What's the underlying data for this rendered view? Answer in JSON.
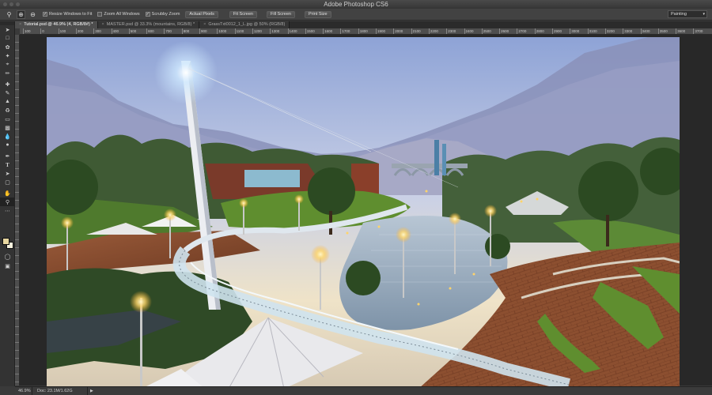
{
  "app": {
    "title": "Adobe Photoshop CS6"
  },
  "options_bar": {
    "checkboxes": [
      {
        "label": "Resize Windows to Fit",
        "checked": true
      },
      {
        "label": "Zoom All Windows",
        "checked": false
      },
      {
        "label": "Scrubby Zoom",
        "checked": true
      }
    ],
    "buttons": [
      "Actual Pixels",
      "Fit Screen",
      "Fill Screen",
      "Print Size"
    ],
    "workspace": "Painting"
  },
  "tabs": [
    {
      "label": "Tutorial.psd @ 46.9% (4, RGB/8#) *",
      "active": true
    },
    {
      "label": "MASTER.psd @ 33.3% (mountains, RGB/8) *",
      "active": false
    },
    {
      "label": "GrassTxt0012_1_L.jpg @ 50% (RGB/8)",
      "active": false
    }
  ],
  "ruler_ticks": [
    "100",
    "0",
    "100",
    "200",
    "300",
    "400",
    "500",
    "600",
    "700",
    "800",
    "900",
    "1000",
    "1100",
    "1200",
    "1300",
    "1400",
    "1500",
    "1600",
    "1700",
    "1800",
    "1900",
    "2000",
    "2100",
    "2200",
    "2300",
    "2400",
    "2500",
    "2600",
    "2700",
    "2800",
    "2900",
    "3000",
    "3100",
    "3200",
    "3300",
    "3400",
    "3500",
    "3600",
    "3700"
  ],
  "status": {
    "zoom": "46.9%",
    "doc": "Doc: 23.1M/1.62G"
  },
  "colors": {
    "foreground": "#e8d7a0",
    "background": "#f4f0dc"
  }
}
